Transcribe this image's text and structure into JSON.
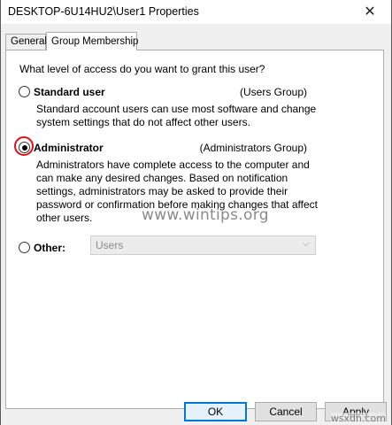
{
  "window": {
    "title": "DESKTOP-6U14HU2\\User1 Properties",
    "close_glyph": "✕"
  },
  "tabs": [
    {
      "label": "General",
      "selected": false
    },
    {
      "label": "Group Membership",
      "selected": true
    }
  ],
  "panel": {
    "question": "What level of access do you want to grant this user?",
    "options": {
      "standard": {
        "label": "Standard user",
        "group": "(Users Group)",
        "description": "Standard account users can use most software and change system settings that do not affect other users.",
        "checked": false
      },
      "administrator": {
        "label": "Administrator",
        "group": "(Administrators Group)",
        "description": "Administrators have complete access to the computer and can make any desired changes. Based on notification settings, administrators may be asked to provide their password or confirmation before making changes that affect other users.",
        "checked": true
      },
      "other": {
        "label": "Other:",
        "select_value": "Users",
        "checked": false
      }
    },
    "watermark": "www.wintips.org"
  },
  "buttons": {
    "ok": "OK",
    "cancel": "Cancel",
    "apply": "Apply"
  },
  "corner_brand": "wsxdn.com",
  "colors": {
    "highlight_ring": "#e0101b",
    "default_button_border": "#0078d7"
  }
}
